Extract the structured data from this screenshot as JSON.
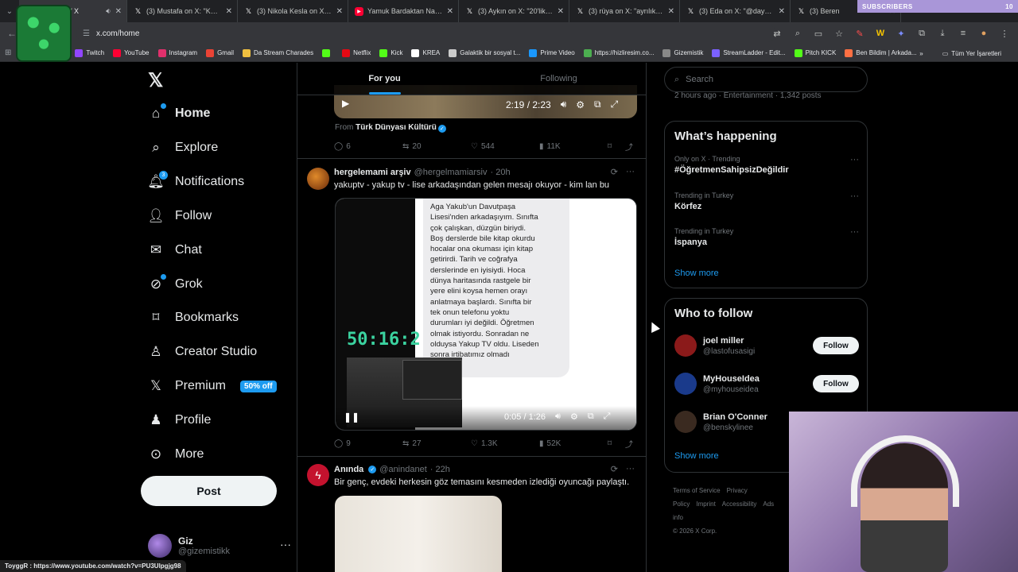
{
  "browser": {
    "tabs": [
      {
        "title": "(3) Home / X",
        "icon": "x-icon",
        "active": true
      },
      {
        "title": "(3) Mustafa on X: \"Kadınlı",
        "icon": "x-icon"
      },
      {
        "title": "(3) Nikola Kesla on X: \"Tar",
        "icon": "x-icon"
      },
      {
        "title": "Yamuk Bardaktan Nasıl Su",
        "icon": "youtube-icon"
      },
      {
        "title": "(3) Aykın on X: \"20'lik düş",
        "icon": "x-icon"
      },
      {
        "title": "(3) rüya on X: \"ayrılık ss'i",
        "icon": "x-icon"
      },
      {
        "title": "(3) Eda on X: \"@dayagiye",
        "icon": "x-icon"
      },
      {
        "title": "(3) Beren",
        "icon": "x-icon"
      }
    ],
    "subscribers_label": "SUBSCRIBERS",
    "subscribers_count": "10",
    "url": "x.com/home",
    "bookmarks": [
      {
        "label": "Twitch",
        "color": "#9146ff"
      },
      {
        "label": "YouTube",
        "color": "#ff0033"
      },
      {
        "label": "Instagram",
        "color": "#e1306c"
      },
      {
        "label": "Gmail",
        "color": "#ea4335"
      },
      {
        "label": "Da Stream Charades",
        "color": "#f0c040"
      },
      {
        "label": "",
        "color": "#53fc18"
      },
      {
        "label": "Netflix",
        "color": "#e50914"
      },
      {
        "label": "Kick",
        "color": "#53fc18"
      },
      {
        "label": "KREA",
        "color": "#ffffff"
      },
      {
        "label": "Galaktik bir sosyal t...",
        "color": "#cccccc"
      },
      {
        "label": "Prime Video",
        "color": "#1a98ff"
      },
      {
        "label": "https://hizliresim.co...",
        "color": "#4caf50"
      },
      {
        "label": "Gizemistik",
        "color": "#888888"
      },
      {
        "label": "StreamLadder - Edit...",
        "color": "#7b61ff"
      },
      {
        "label": "Pitch KICK",
        "color": "#53fc18"
      },
      {
        "label": "Ben Bildim | Arkada...",
        "color": "#ff7043"
      }
    ],
    "bookmarks_overflow": "»",
    "all_bookmarks": "Tüm Yer İşaretleri"
  },
  "nav": {
    "items": [
      {
        "label": "Home",
        "icon": "home-icon",
        "name": "nav-home"
      },
      {
        "label": "Explore",
        "icon": "search-icon",
        "name": "nav-explore"
      },
      {
        "label": "Notifications",
        "icon": "bell-icon",
        "name": "nav-notifications",
        "badge": "3"
      },
      {
        "label": "Follow",
        "icon": "add-person-icon",
        "name": "nav-follow"
      },
      {
        "label": "Chat",
        "icon": "mail-icon",
        "name": "nav-chat"
      },
      {
        "label": "Grok",
        "icon": "grok-icon",
        "name": "nav-grok"
      },
      {
        "label": "Bookmarks",
        "icon": "bookmark-icon",
        "name": "nav-bookmarks"
      },
      {
        "label": "Creator Studio",
        "icon": "creator-icon",
        "name": "nav-creator-studio"
      },
      {
        "label": "Premium",
        "icon": "x-icon",
        "name": "nav-premium"
      },
      {
        "label": "Profile",
        "icon": "person-icon",
        "name": "nav-profile"
      },
      {
        "label": "More",
        "icon": "more-circle-icon",
        "name": "nav-more"
      }
    ],
    "premium_badge": "50% off",
    "post_label": "Post",
    "account": {
      "name": "Giz",
      "handle": "@gizemistikk"
    }
  },
  "timeline": {
    "tabs": [
      "For you",
      "Following"
    ],
    "tweet1": {
      "video_time": "2:19 / 2:23",
      "from_prefix": "From",
      "from_source": "Türk Dünyası Kültürü",
      "replies": "6",
      "reposts": "20",
      "likes": "544",
      "views": "11K"
    },
    "tweet2": {
      "name": "hergelemami arşiv",
      "handle": "@hergelmamiarsiv",
      "time": "· 20h",
      "text": "yakuptv - yakup tv - lise arkadaşından gelen mesajı okuyor - kim lan bu",
      "message_lines": "Aga Yakub'un Davutpaşa\nLisesi'nden arkadaşıyım. Sınıfta\nçok çalışkan, düzgün biriydi.\nBoş derslerde bile kitap okurdu\nhocalar ona okuması için kitap\ngetirirdi. Tarih ve coğrafya\nderslerinde en iyisiydi. Hoca\ndünya haritasında rastgele bir\nyere elini koysa hemen orayı\nanlatmaya başlardı. Sınıfta bir\ntek onun telefonu yoktu\ndurumları iyi değildi. Öğretmen\nolmak istiyordu. Sonradan ne\nolduysa Yakup TV oldu. Liseden\nsonra irtibatımız olmadı",
      "clock": "50:16:2",
      "video_time": "0:05 / 1:26",
      "replies": "9",
      "reposts": "27",
      "likes": "1.3K",
      "views": "52K"
    },
    "tweet3": {
      "name": "Anında",
      "handle": "@anindanet",
      "time": "· 22h",
      "text": "Bir genç, evdeki herkesin göz temasını kesmeden izlediği oyuncağı paylaştı."
    }
  },
  "right": {
    "search_placeholder": "Search",
    "peek_text": "2 hours ago · Entertainment · 1,342 posts",
    "happening_title": "What’s happening",
    "trends": [
      {
        "context": "Only on X · Trending",
        "title": "#ÖğretmenSahipsizDeğildir"
      },
      {
        "context": "Trending in Turkey",
        "title": "Körfez"
      },
      {
        "context": "Trending in Turkey",
        "title": "İspanya"
      }
    ],
    "show_more": "Show more",
    "wtf_title": "Who to follow",
    "suggestions": [
      {
        "name": "joel miller",
        "handle": "@lastofusasigi",
        "button": "Follow",
        "color": "#8b1a1a"
      },
      {
        "name": "MyHouseIdea",
        "handle": "@myhouseidea",
        "button": "Follow",
        "color": "#1a3a8b"
      },
      {
        "name": "Brian O'Conner",
        "handle": "@benskylinee",
        "button": "",
        "color": "#3a2a20"
      }
    ],
    "footer_links": [
      "Terms of Service",
      "Privacy Policy",
      "Imprint",
      "Accessibility",
      "Ads info"
    ],
    "copyright": "© 2026 X Corp."
  },
  "status_url": "ToyggR : https://www.youtube.com/watch?v=PU3Ulpgjg98"
}
